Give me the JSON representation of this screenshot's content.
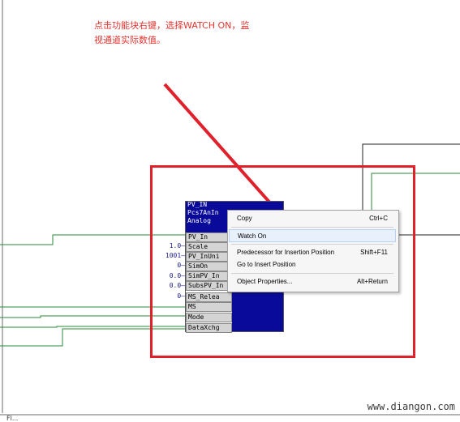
{
  "annotation": {
    "line1": "点击功能块右键，选择WATCH ON，监",
    "line2": "视通道实际数值。"
  },
  "function_block": {
    "header_lines": [
      "PV_IN",
      "Pcs7AnIn",
      "Analog"
    ],
    "pins": [
      {
        "label": "PV_In",
        "value": ""
      },
      {
        "label": "Scale",
        "value": "1.0—"
      },
      {
        "label": "PV_InUni",
        "value": "1001—"
      },
      {
        "label": "SimOn",
        "value": "0—"
      },
      {
        "label": "SimPV_In",
        "value": "0.0—"
      },
      {
        "label": "SubsPV_In",
        "value": "0.0—"
      },
      {
        "label": "MS_Relea",
        "value": "0—"
      },
      {
        "label": "MS",
        "value": ""
      },
      {
        "label": "Mode",
        "value": ""
      },
      {
        "label": "DataXchg",
        "value": ""
      }
    ]
  },
  "context_menu": {
    "items": [
      {
        "label": "Copy",
        "shortcut": "Ctrl+C"
      },
      {
        "label": "Watch On",
        "shortcut": ""
      },
      {
        "label": "Predecessor for Insertion Position",
        "shortcut": "Shift+F11"
      },
      {
        "label": "Go to Insert Position",
        "shortcut": ""
      },
      {
        "label": "Object Properties...",
        "shortcut": "Alt+Return"
      }
    ]
  },
  "watermark": "www.diangon.com",
  "bottom_text": "Fl..."
}
